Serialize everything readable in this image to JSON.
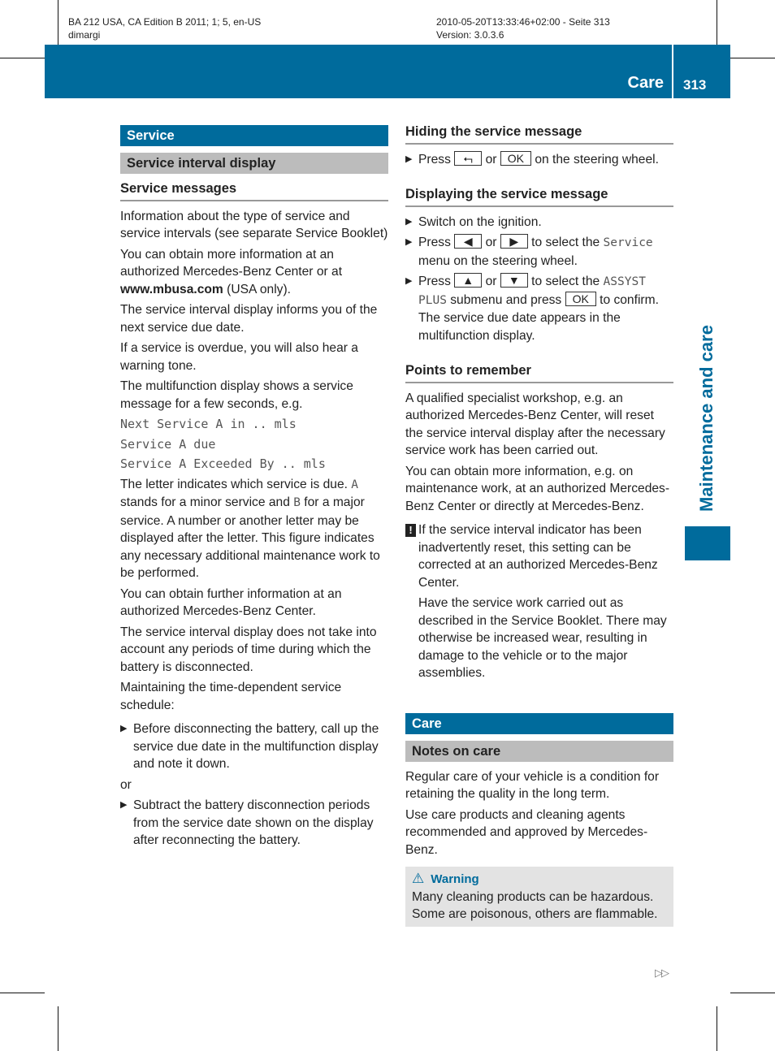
{
  "meta": {
    "left_line1": "BA 212 USA, CA Edition B 2011; 1; 5, en-US",
    "left_line2": "dimargi",
    "right_line1": "2010-05-20T13:33:46+02:00 - Seite 313",
    "right_line2": "Version: 3.0.3.6"
  },
  "header": {
    "section": "Care",
    "page": "313"
  },
  "side_title": "Maintenance and care",
  "colors": {
    "accent": "#006b9c",
    "subheader": "#bcbcbc",
    "warning_bg": "#e3e3e3"
  },
  "left": {
    "h1": "Service",
    "h2": "Service interval display",
    "h3": "Service messages",
    "p1": "Information about the type of service and service intervals (see separate Service Booklet)",
    "p2a": "You can obtain more information at an authorized Mercedes-Benz Center or at ",
    "p2link": "www.mbusa.com",
    "p2b": " (USA only).",
    "p3": "The service interval display informs you of the next service due date.",
    "p4": "If a service is overdue, you will also hear a warning tone.",
    "p5": "The multifunction display shows a service message for a few seconds, e.g.",
    "mono": [
      "Next Service A in .. mls",
      "Service A due",
      "Service A Exceeded By .. mls"
    ],
    "p6a": "The letter indicates which service is due. ",
    "p6A": "A",
    "p6b": " stands for a minor service and ",
    "p6B": "B",
    "p6c": " for a major service. A number or another letter may be displayed after the letter. This figure indicates any necessary additional maintenance work to be performed.",
    "p7": "You can obtain further information at an authorized Mercedes-Benz Center.",
    "p8": "The service interval display does not take into account any periods of time during which the battery is disconnected.",
    "p9": "Maintaining the time-dependent service schedule:",
    "step1": "Before disconnecting the battery, call up the service due date in the multifunction display and note it down.",
    "or": "or",
    "step2": "Subtract the battery disconnection periods from the service date shown on the display after reconnecting the battery."
  },
  "right": {
    "h3a": "Hiding the service message",
    "hide_press": "Press",
    "hide_or": "or",
    "key_back": "⮢",
    "key_ok": "OK",
    "hide_rest": "on the steering wheel.",
    "h3b": "Displaying the service message",
    "s1": "Switch on the ignition.",
    "s2_press": "Press",
    "s2_or": "or",
    "key_left": "◀",
    "key_right": "▶",
    "s2a": "to select the ",
    "s2m": "Service",
    "s2b": " menu on the steering wheel.",
    "s3_press": "Press",
    "s3_or": "or",
    "key_up": "▲",
    "key_down": "▼",
    "s3a": "to select the ",
    "s3m": "ASSYST PLUS",
    "s3b": " submenu and press ",
    "s3c": " to confirm.",
    "s3d": "The service due date appears in the multifunction display.",
    "h3c": "Points to remember",
    "pr1": "A qualified specialist workshop, e.g. an authorized Mercedes-Benz Center, will reset the service interval display after the necessary service work has been carried out.",
    "pr2": "You can obtain more information, e.g. on maintenance work, at an authorized Mercedes-Benz Center or directly at Mercedes-Benz.",
    "note_icon": "!",
    "note1": "If the service interval indicator has been inadvertently reset, this setting can be corrected at an authorized Mercedes-Benz Center.",
    "note2": "Have the service work carried out as described in the Service Booklet. There may otherwise be increased wear, resulting in damage to the vehicle or to the major assemblies.",
    "h1": "Care",
    "h2": "Notes on care",
    "c1": "Regular care of your vehicle is a condition for retaining the quality in the long term.",
    "c2": "Use care products and cleaning agents recommended and approved by Mercedes-Benz.",
    "warn_icon": "⚠",
    "warn_title": "Warning",
    "warn_text": "Many cleaning products can be hazardous. Some are poisonous, others are flammable."
  },
  "continue_mark": "▷▷"
}
